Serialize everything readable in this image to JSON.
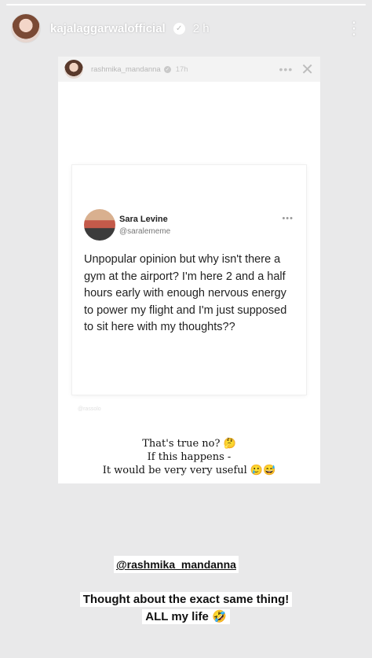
{
  "story": {
    "progress": 1.0,
    "username": "kajalaggarwalofficial",
    "time": "2 h",
    "more_icon": "⋮",
    "verified_icon": "✓"
  },
  "shared_post": {
    "username": "rashmika_mandanna",
    "time": "17h",
    "dots": "•••",
    "close_icon": "✕",
    "check_icon": "✓",
    "tweet": {
      "name": "Sara Levine",
      "handle": "@saralememe",
      "dots": "•••",
      "text": "Unpopular opinion but why isn't there a gym at the airport? I'm here 2 and a half hours early with enough nervous energy to power my flight and I'm just supposed to sit here with my thoughts??"
    },
    "watermark": "@rassolo",
    "caption": [
      "That's true no? 🤔",
      "If this happens -",
      "It would be very very useful 🥲😅"
    ]
  },
  "mention": "@rashmika_mandanna",
  "bottom_text": [
    "Thought about the exact same thing!",
    "ALL my life 🤣"
  ]
}
